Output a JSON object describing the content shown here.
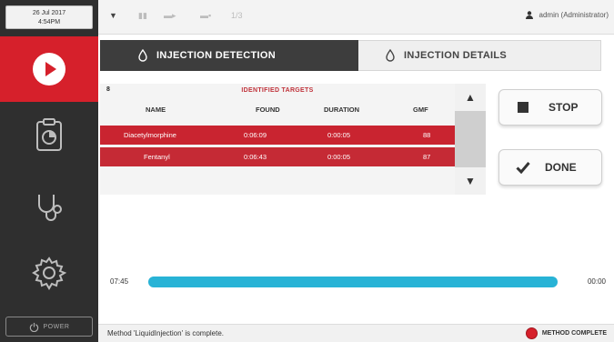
{
  "header": {
    "date": "26 Jul 2017",
    "time": "4:54PM",
    "page_indicator": "1/3",
    "user": "admin (Administrator)"
  },
  "sidebar": {
    "items": [
      {
        "icon": "play-icon",
        "active": true
      },
      {
        "icon": "clipboard-pie-icon",
        "active": false
      },
      {
        "icon": "stethoscope-icon",
        "active": false
      },
      {
        "icon": "gear-icon",
        "active": false
      }
    ],
    "power_label": "POWER"
  },
  "tabs": [
    {
      "label": "INJECTION DETECTION",
      "active": true
    },
    {
      "label": "INJECTION DETAILS",
      "active": false
    }
  ],
  "targets": {
    "count": "8",
    "title": "IDENTIFIED TARGETS",
    "columns": [
      "NAME",
      "FOUND",
      "DURATION",
      "GMF"
    ],
    "rows": [
      {
        "name": "Diacetylmorphine",
        "found": "0:06:09",
        "duration": "0:00:05",
        "gmf": "88"
      },
      {
        "name": "Fentanyl",
        "found": "0:06:43",
        "duration": "0:00:05",
        "gmf": "87"
      }
    ]
  },
  "actions": {
    "stop_label": "STOP",
    "done_label": "DONE"
  },
  "progress": {
    "elapsed": "07:45",
    "remaining": "00:00",
    "fraction": 1.0
  },
  "status": {
    "message": "Method 'LiquidInjection' is complete.",
    "method_state": "METHOD COMPLETE"
  },
  "colors": {
    "accent_red": "#d6202b",
    "progress_blue": "#28b3d6",
    "sidebar_dark": "#2f2f2f"
  }
}
